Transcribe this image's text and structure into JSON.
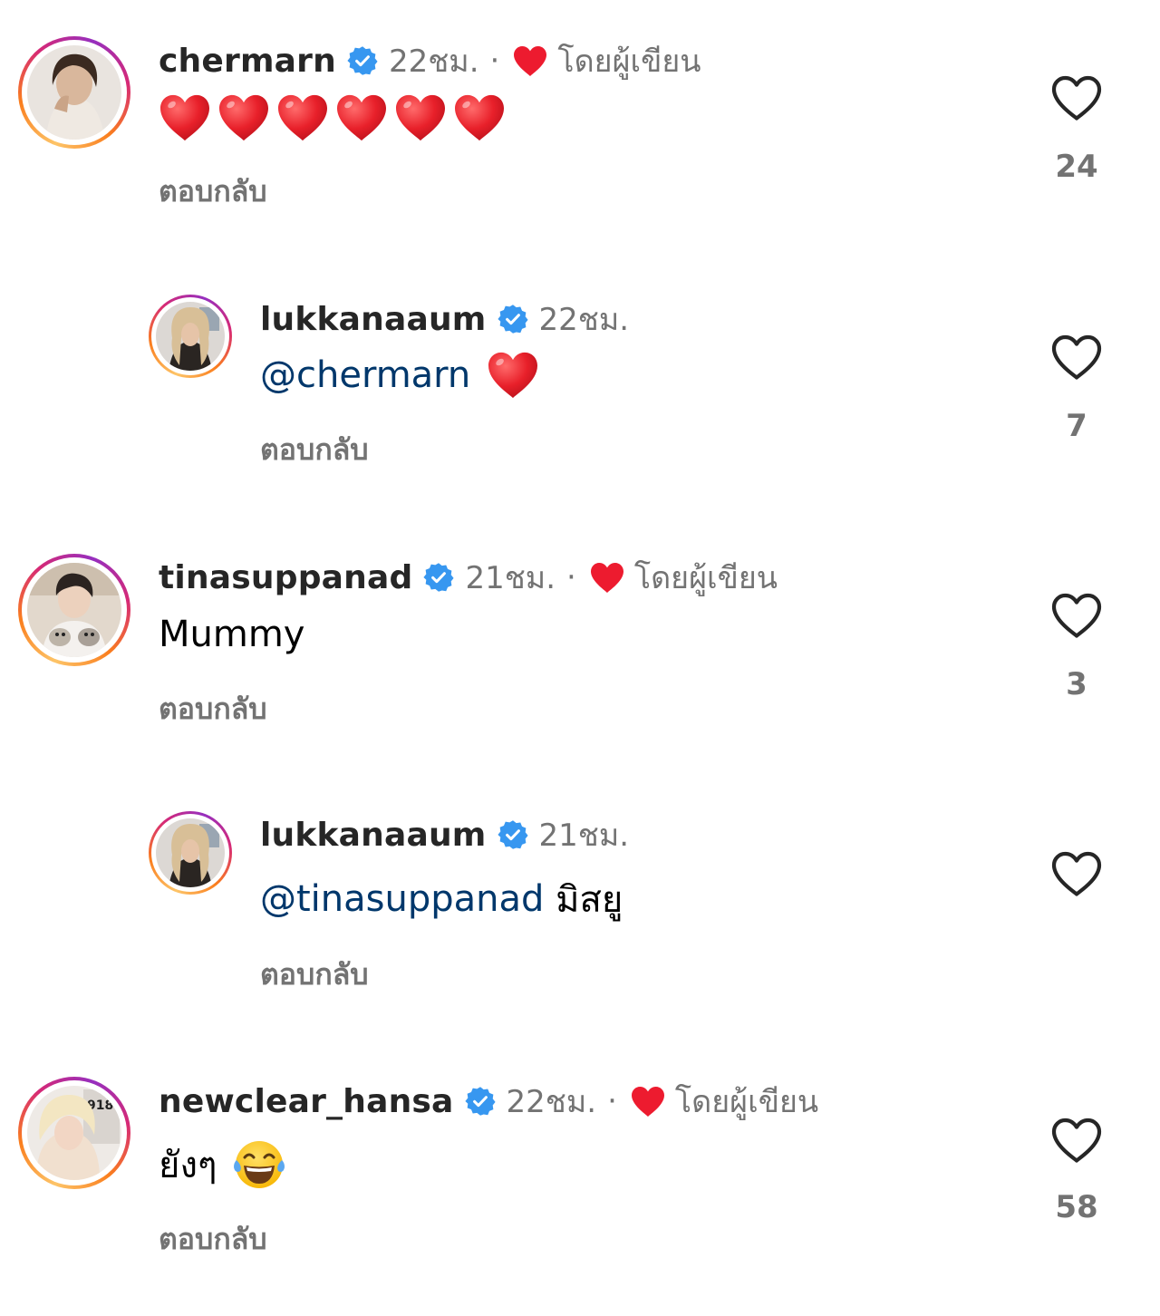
{
  "comments": [
    {
      "username": "chermarn",
      "time": "22ชม.",
      "separator": "·",
      "author_label": "โดยผู้เขียน",
      "body_mention": "",
      "body_text": "",
      "reply_label": "ตอบกลับ",
      "like_count": "24",
      "avatar_icon": "avatar-photo",
      "body_emoji": "red-heart-emoji ×6"
    },
    {
      "username": "lukkanaaum",
      "time": "22ชม.",
      "body_mention": "@chermarn",
      "body_text": "",
      "reply_label": "ตอบกลับ",
      "like_count": "7",
      "body_emoji": "red-heart-emoji ×1"
    },
    {
      "username": "tinasuppanad",
      "time": "21ชม.",
      "separator": "·",
      "author_label": "โดยผู้เขียน",
      "body_mention": "",
      "body_text": "Mummy",
      "reply_label": "ตอบกลับ",
      "like_count": "3"
    },
    {
      "username": "lukkanaaum",
      "time": "21ชม.",
      "body_mention": "@tinasuppanad",
      "body_text": " มิสยู",
      "reply_label": "ตอบกลับ",
      "like_count": ""
    },
    {
      "username": "newclear_hansa",
      "time": "22ชม.",
      "separator": "·",
      "author_label": "โดยผู้เขียน",
      "body_mention": "",
      "body_text": "ยังๆ",
      "reply_label": "ตอบกลับ",
      "like_count": "58",
      "body_emoji": "tears-of-joy-emoji"
    }
  ],
  "colors": {
    "username": "#262626",
    "meta": "#737373",
    "mention": "#00376b",
    "verified": "#3797f0",
    "heart_red": "#ed1b2f",
    "like_icon": "#262626"
  },
  "icons": {
    "verified": "verified-badge-icon",
    "author_heart": "heart-filled-icon",
    "like": "heart-outline-icon"
  }
}
